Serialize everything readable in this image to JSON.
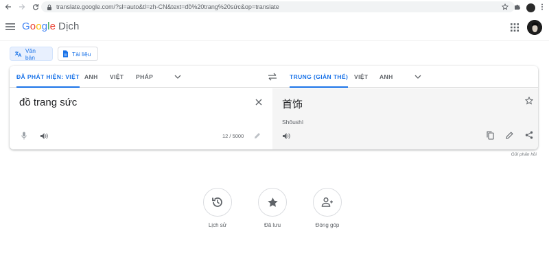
{
  "browser": {
    "url": "translate.google.com/?sl=auto&tl=zh-CN&text=đồ%20trang%20sức&op=translate"
  },
  "header": {
    "logo_parts": [
      "G",
      "o",
      "o",
      "g",
      "l",
      "e"
    ],
    "product": "Dịch"
  },
  "modes": {
    "text_label": "Văn bản",
    "doc_label": "Tài liệu"
  },
  "source_langs": {
    "detected": "ĐÃ PHÁT HIỆN: VIỆT",
    "l1": "ANH",
    "l2": "VIỆT",
    "l3": "PHÁP"
  },
  "target_langs": {
    "selected": "TRUNG (GIẢN THỂ)",
    "l1": "VIỆT",
    "l2": "ANH"
  },
  "source": {
    "text": "đồ trang sức",
    "counter": "12 / 5000"
  },
  "target": {
    "text": "首饰",
    "pinyin": "Shǒushì"
  },
  "feedback": "Gửi phản hồi",
  "actions": {
    "history": "Lịch sử",
    "saved": "Đã lưu",
    "contribute": "Đóng góp"
  },
  "colors": {
    "accent": "#1a73e8",
    "icon": "#5f6368"
  }
}
